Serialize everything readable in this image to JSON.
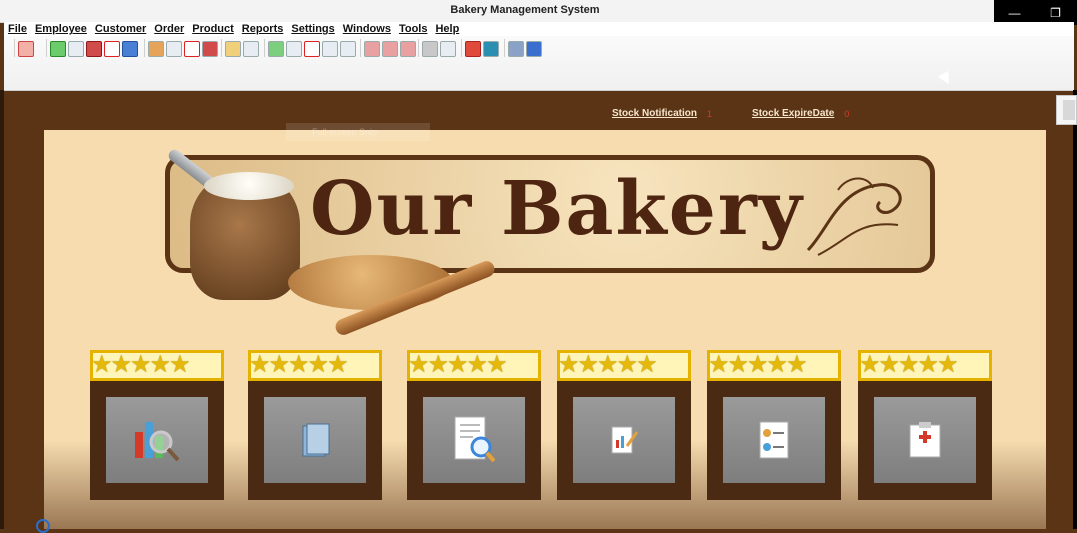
{
  "window": {
    "title": "Bakery Management System",
    "minimize": "—",
    "restore": "❐"
  },
  "menubar": {
    "items": [
      "File",
      "Employee",
      "Customer",
      "Order",
      "Product",
      "Reports",
      "Settings",
      "Windows",
      "Tools",
      "Help"
    ]
  },
  "toolbar": {
    "icons": [
      "exit-icon",
      "add-icon",
      "edit-icon",
      "save-icon",
      "delete-icon",
      "refresh-icon",
      "employee-icon",
      "employee-edit-icon",
      "employee-delete-icon",
      "employee-save-icon",
      "customer-icon",
      "customer-grid-icon",
      "order-icon",
      "order-edit-icon",
      "order-delete-icon",
      "order-grid-icon",
      "order-export-icon",
      "product-icon",
      "product-add-icon",
      "product-remove-icon",
      "settings-icon",
      "settings-edit-icon",
      "report-pie-icon",
      "report-db-icon",
      "tools-icon",
      "help-icon"
    ]
  },
  "notifications": {
    "stock_notification_label": "Stock Notification",
    "stock_notification_count": "1",
    "stock_expire_label": "Stock ExpireDate",
    "stock_expire_count": "0"
  },
  "overlay": {
    "ghost_text": "Full-screen Snip"
  },
  "banner": {
    "title": "Our Bakery"
  },
  "cards": [
    {
      "icon": "search-report-icon"
    },
    {
      "icon": "books-icon"
    },
    {
      "icon": "document-search-icon"
    },
    {
      "icon": "edit-report-icon"
    },
    {
      "icon": "contacts-list-icon"
    },
    {
      "icon": "medical-clipboard-icon"
    }
  ],
  "colors": {
    "background": "#5b3416",
    "panel": "#f7dcb0",
    "link": "#f5e6cc",
    "count": "#d43a2a",
    "star": "#e4b90c",
    "card": "#4a2a12"
  }
}
